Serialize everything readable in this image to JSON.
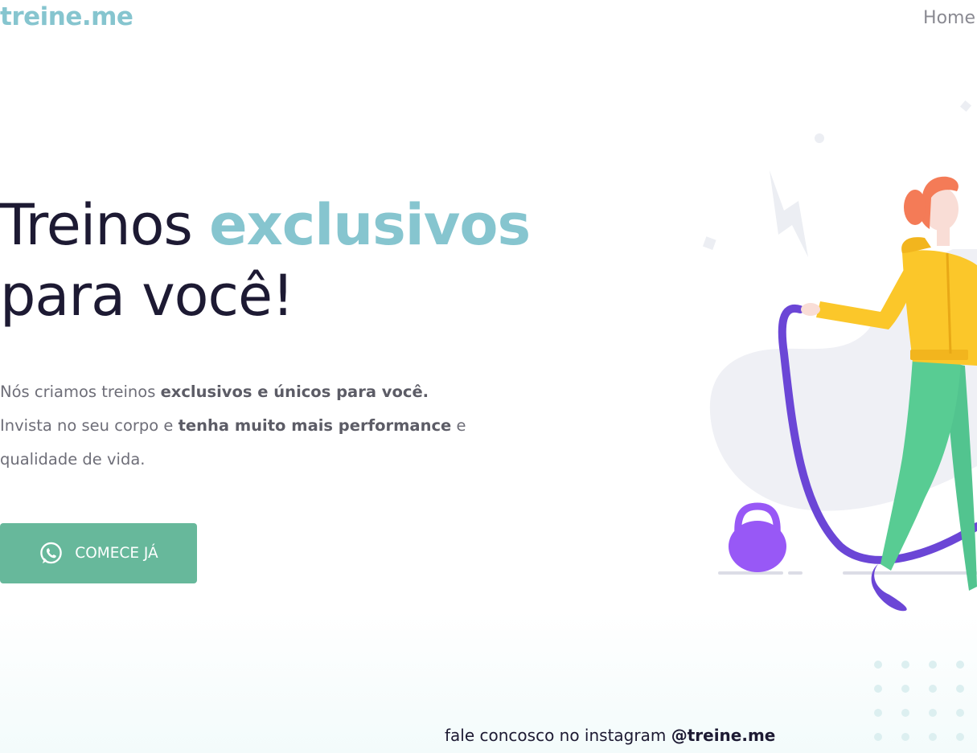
{
  "header": {
    "logo": "treine.me",
    "nav": {
      "home_label": "Home"
    }
  },
  "hero": {
    "title_line1_prefix": "Treinos ",
    "title_line1_accent": "exclusivos",
    "title_line2": "para você!",
    "desc": {
      "part1": "Nós criamos treinos ",
      "part2_bold": "exclusivos e únicos para você.",
      "part3": "Invista no seu corpo e ",
      "part4_bold": "tenha muito mais performance",
      "part5": " e qualidade de vida."
    },
    "cta": {
      "label": "COMECE JÁ",
      "icon": "whatsapp-icon"
    }
  },
  "footer": {
    "prefix": "fale concosco no instagram ",
    "handle": "@treine.me"
  },
  "colors": {
    "accent": "#86c5cf",
    "button": "#67b89b",
    "heading": "#1d1a33",
    "text": "#6e6e78",
    "shirt": "#fbc72a",
    "pants": "#58cc93",
    "rope": "#6b46d6",
    "kettlebell": "#9858f6",
    "hair": "#f47b57"
  }
}
